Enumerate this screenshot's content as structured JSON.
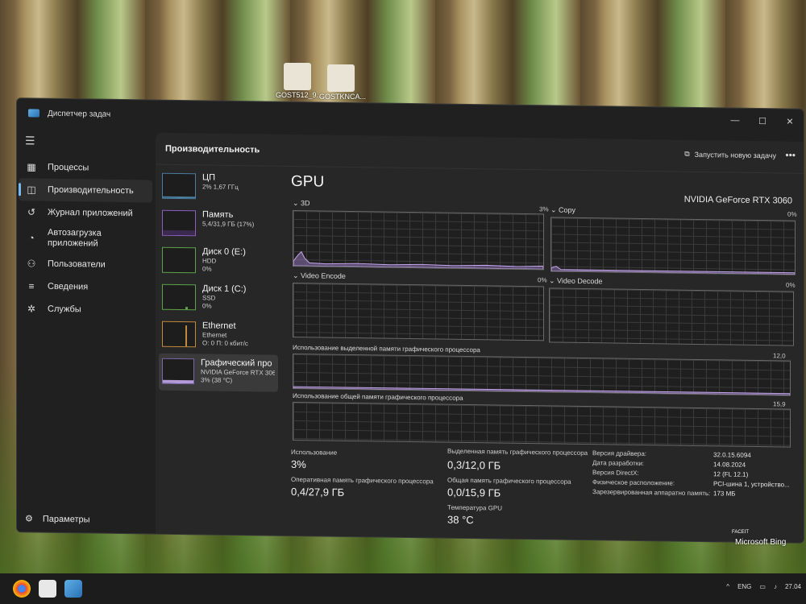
{
  "desktop": {
    "icons": [
      {
        "label": "GOST512_9..."
      },
      {
        "label": "GOSTKNCA..."
      }
    ],
    "watermark": "Microsoft Bing",
    "facet": "FACEIT"
  },
  "window": {
    "title": "Диспетчер задач",
    "controls": {
      "minimize": "—",
      "maximize": "☐",
      "close": "✕"
    }
  },
  "sidebar": {
    "items": [
      {
        "label": "Процессы",
        "icon": "grid-icon"
      },
      {
        "label": "Производительность",
        "icon": "chart-icon"
      },
      {
        "label": "Журнал приложений",
        "icon": "history-icon"
      },
      {
        "label": "Автозагрузка приложений",
        "icon": "speed-icon"
      },
      {
        "label": "Пользователи",
        "icon": "users-icon"
      },
      {
        "label": "Сведения",
        "icon": "list-icon"
      },
      {
        "label": "Службы",
        "icon": "puzzle-icon"
      }
    ],
    "settings": "Параметры"
  },
  "header": {
    "title": "Производительность",
    "new_task": "Запустить новую задачу",
    "more": "•••"
  },
  "perf_list": [
    {
      "title": "ЦП",
      "line1": "2% 1,67 ГГц",
      "line2": ""
    },
    {
      "title": "Память",
      "line1": "5,4/31,9 ГБ (17%)",
      "line2": ""
    },
    {
      "title": "Диск 0 (E:)",
      "line1": "HDD",
      "line2": "0%"
    },
    {
      "title": "Диск 1 (C:)",
      "line1": "SSD",
      "line2": "0%"
    },
    {
      "title": "Ethernet",
      "line1": "Ethernet",
      "line2": "О: 0 П: 0 кбит/с"
    },
    {
      "title": "Графический про",
      "line1": "NVIDIA GeForce RTX 3060",
      "line2": "3% (38 °C)"
    }
  ],
  "gpu": {
    "title": "GPU",
    "name": "NVIDIA GeForce RTX 3060",
    "graphs": {
      "g3d": {
        "label": "3D",
        "pct": "3%"
      },
      "copy": {
        "label": "Copy",
        "pct": "0%"
      },
      "encode": {
        "label": "Video Encode",
        "pct": "0%"
      },
      "decode": {
        "label": "Video Decode",
        "pct": "0%"
      },
      "dedicated": {
        "label": "Использование выделенной памяти графического процессора",
        "max": "12,0 ГБ"
      },
      "shared": {
        "label": "Использование общей памяти графического процессора",
        "max": "15,9 ГБ"
      }
    },
    "stats": {
      "usage_label": "Использование",
      "usage": "3%",
      "ram_label": "Оперативная память графического процессора",
      "ram": "0,4/27,9 ГБ",
      "dedicated_label": "Выделенная память графического процессора",
      "dedicated": "0,3/12,0 ГБ",
      "shared_label": "Общая память графического процессора",
      "shared": "0,0/15,9 ГБ",
      "temp_label": "Температура GPU",
      "temp": "38 °C"
    },
    "details": [
      {
        "k": "Версия драйвера:",
        "v": "32.0.15.6094"
      },
      {
        "k": "Дата разработки:",
        "v": "14.08.2024"
      },
      {
        "k": "Версия DirectX:",
        "v": "12 (FL 12.1)"
      },
      {
        "k": "Физическое расположение:",
        "v": "PCI-шина 1, устройство..."
      },
      {
        "k": "Зарезервированная аппаратно память:",
        "v": "173 МБ"
      }
    ]
  },
  "taskbar": {
    "lang": "ENG",
    "date": "27.04"
  }
}
